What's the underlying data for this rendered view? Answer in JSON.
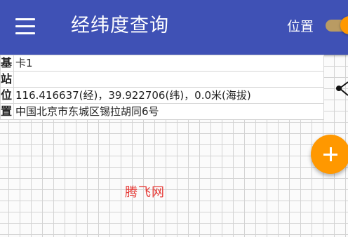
{
  "header": {
    "title": "经纬度查询",
    "position_label": "位置",
    "position_toggle_on": true,
    "accent_color": "#3f51b5",
    "toggle_color": "#ff9800"
  },
  "info": {
    "station_label_1": "基",
    "station_label_2": "站",
    "station_value": "卡1",
    "position_label_1": "位",
    "position_label_2": "置",
    "coords": "116.416637(经)，39.922706(纬)，0.0米(海拔)",
    "address": "中国北京市东城区锡拉胡同6号"
  },
  "icons": {
    "menu": "hamburger-menu-icon",
    "share": "share-icon",
    "fab": "plus-icon"
  },
  "watermark": "腾飞网"
}
